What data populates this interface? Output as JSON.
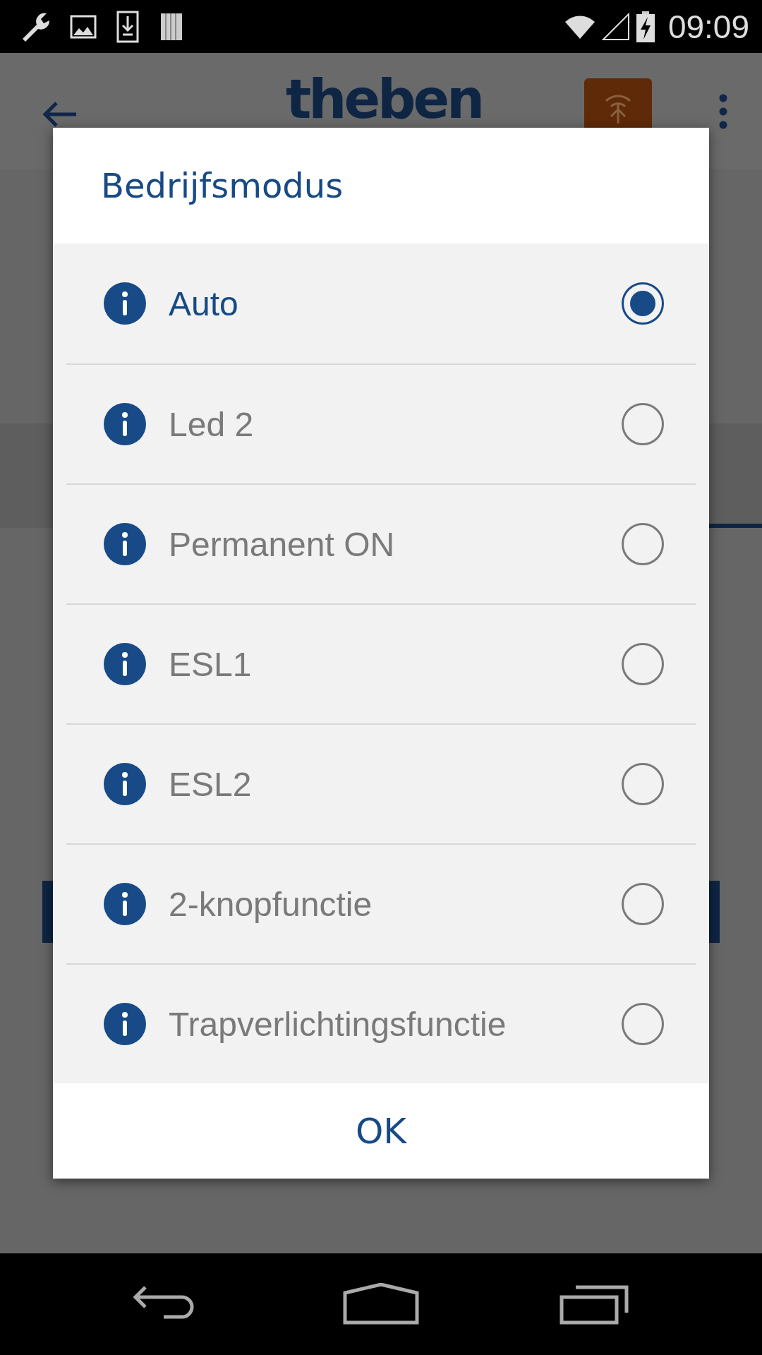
{
  "status_bar": {
    "time": "09:09"
  },
  "app_bar": {
    "logo": "theben"
  },
  "dialog": {
    "title": "Bedrijfsmodus",
    "options": [
      {
        "label": "Auto",
        "selected": true
      },
      {
        "label": "Led 2",
        "selected": false
      },
      {
        "label": "Permanent ON",
        "selected": false
      },
      {
        "label": "ESL1",
        "selected": false
      },
      {
        "label": "ESL2",
        "selected": false
      },
      {
        "label": "2-knopfunctie",
        "selected": false
      },
      {
        "label": "Trapverlichtingsfunctie",
        "selected": false
      }
    ],
    "button": "OK"
  }
}
